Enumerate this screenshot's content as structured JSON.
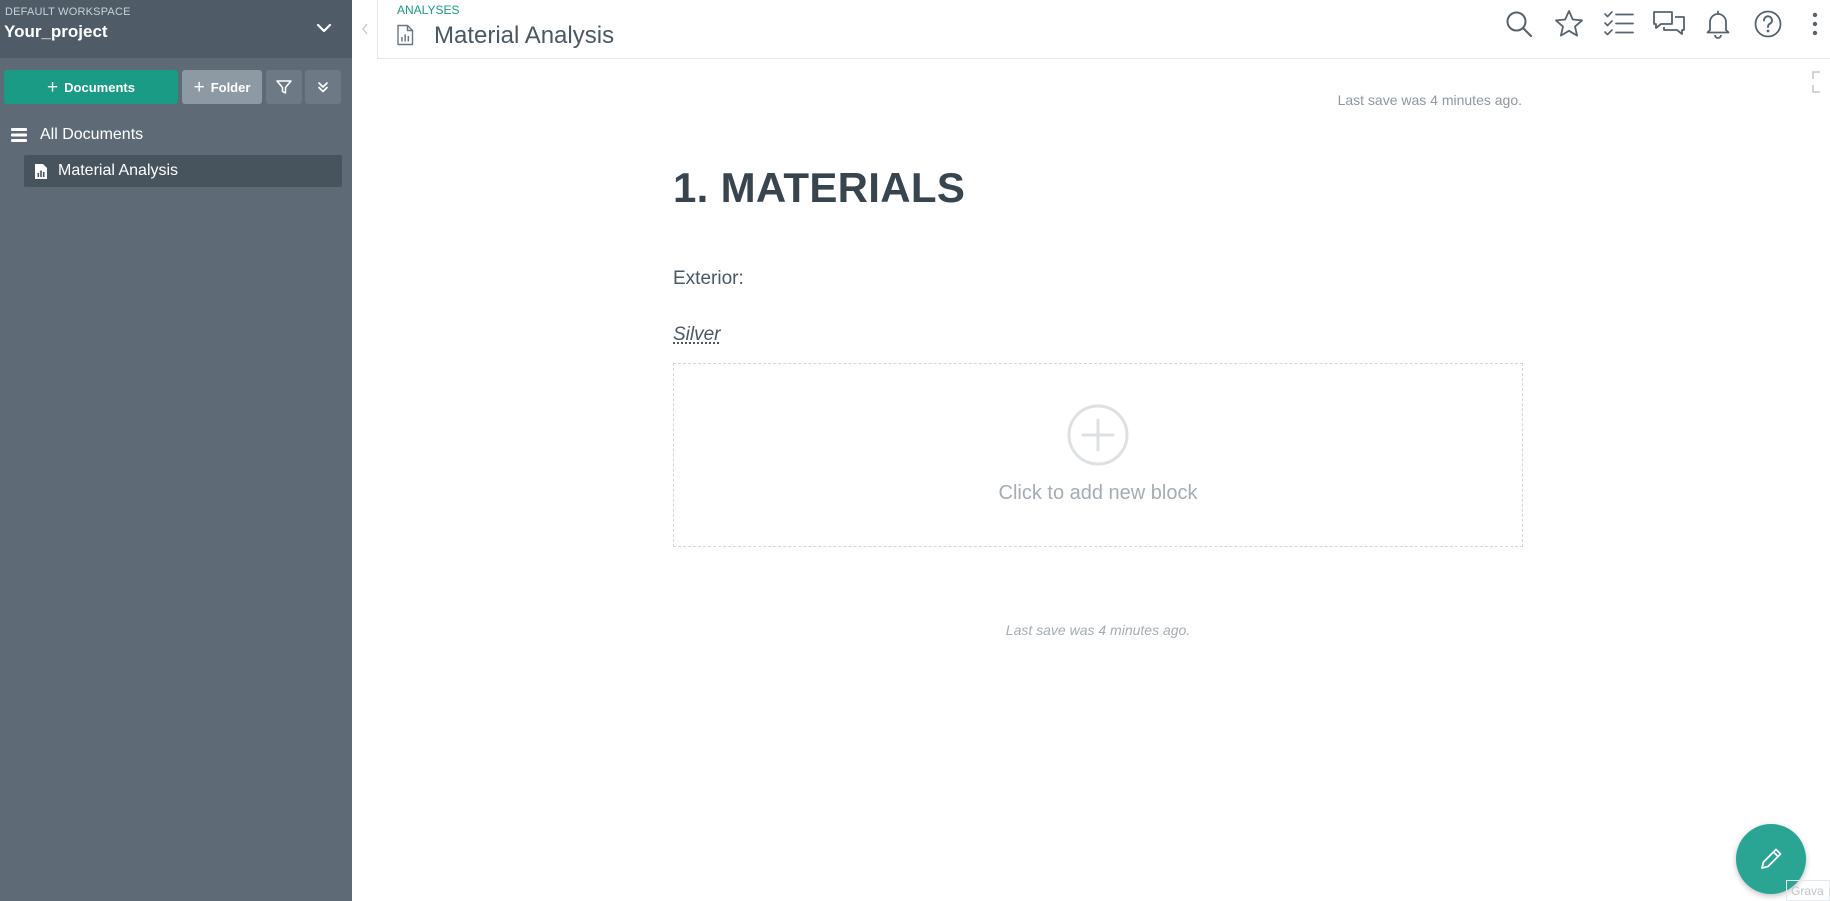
{
  "sidebar": {
    "workspace_label": "DEFAULT WORKSPACE",
    "project_name": "Your_project",
    "buttons": {
      "documents": "Documents",
      "folder": "Folder"
    },
    "nav": {
      "all_documents": "All Documents",
      "active_document": "Material Analysis"
    }
  },
  "header": {
    "breadcrumb": "ANALYSES",
    "title": "Material Analysis",
    "toolbar_icons": [
      "search-icon",
      "star-icon",
      "checklist-icon",
      "comments-icon",
      "bell-icon",
      "help-icon",
      "more-vertical-icon"
    ]
  },
  "editor": {
    "last_save_top": "Last save was 4 minutes ago.",
    "heading": "1. MATERIALS",
    "paragraph_1": "Exterior:",
    "paragraph_2": "Silver",
    "add_block_label": "Click to add new block",
    "last_save_bottom": "Last save was 4 minutes ago."
  },
  "footer": {
    "corner_text": "Grava"
  },
  "colors": {
    "accent": "#1a9b86",
    "sidebar_bg": "#5e6b76",
    "fab": "#2aa594"
  }
}
